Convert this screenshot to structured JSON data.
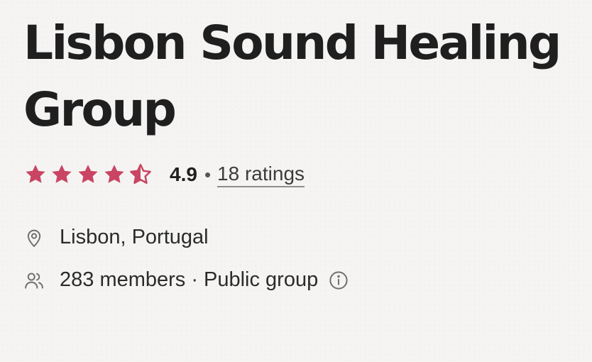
{
  "group": {
    "title": "Lisbon Sound Healing Group",
    "rating": {
      "stars": 4.5,
      "max_stars": 5,
      "value": "4.9",
      "separator": "•",
      "count_label": "18 ratings"
    },
    "location": "Lisbon, Portugal",
    "members": "283 members",
    "members_separator": "·",
    "visibility": "Public group"
  },
  "icons": {
    "star": "star-icon",
    "half_star": "star-half-icon",
    "location": "map-pin-icon",
    "members": "people-icon",
    "info": "info-icon"
  },
  "colors": {
    "star": "#c94563",
    "text": "#1f1f20",
    "muted_icon": "#707070",
    "background": "#f5f4f3"
  }
}
